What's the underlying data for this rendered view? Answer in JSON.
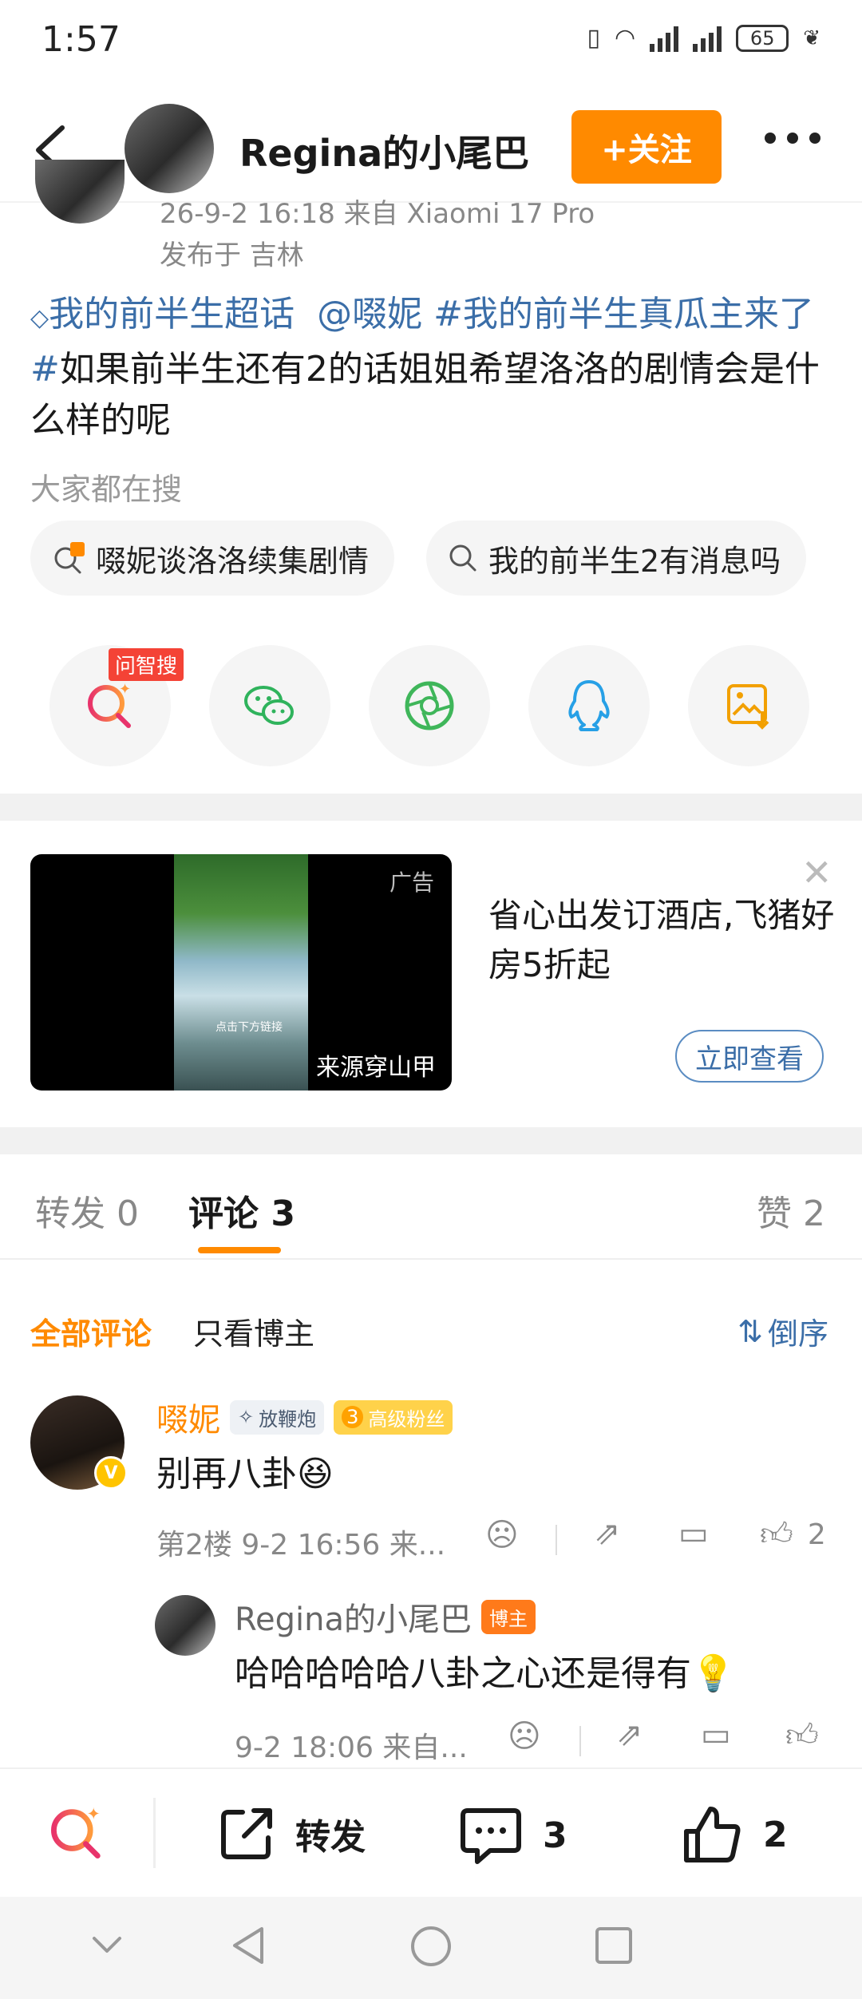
{
  "status": {
    "time": "1:57",
    "battery": "65"
  },
  "header": {
    "title": "Regina的小尾巴",
    "follow_label": "+关注"
  },
  "post": {
    "timestamp": "26-9-2 16:18 来自 Xiaomi 17 Pro",
    "location": "发布于 吉林",
    "text_parts": {
      "supertopic": "我的前半生超话",
      "mention": "@啜妮",
      "hashtag_1": "#我的前半生真瓜主",
      "hashtag_2": "来了#",
      "body": "如果前半生还有2的话姐姐希望洛洛的剧情会是什么样的呢"
    },
    "search_label": "大家都在搜",
    "search_pills": [
      "啜妮谈洛洛续集剧情",
      "我的前半生2有消息吗"
    ],
    "share_tag": "问智搜"
  },
  "ad": {
    "tag": "广告",
    "source": "来源穿山甲",
    "caption": "点击下方链接",
    "title": "省心出发订酒店,飞猪好房5折起",
    "cta": "立即查看"
  },
  "tabs": {
    "repost": "转发 0",
    "comments": "评论 3",
    "likes": "赞 2"
  },
  "filters": {
    "all": "全部评论",
    "blogger_only": "只看博主",
    "sort": "倒序"
  },
  "comments": [
    {
      "name": "啜妮",
      "badge_1": "放鞭炮",
      "badge_2_level": "3",
      "badge_2": "高级粉丝",
      "body": "别再八卦",
      "meta": "第2楼 9-2 16:56 来...",
      "likes": "2"
    }
  ],
  "reply": {
    "name": "Regina的小尾巴",
    "badge": "博主",
    "body": "哈哈哈哈哈八卦之心还是得有",
    "meta": "9-2 18:06 来自..."
  },
  "bottom_bar": {
    "repost": "转发",
    "comments": "3",
    "likes": "2"
  },
  "colors": {
    "accent": "#ff8a00",
    "link": "#3b6ea8",
    "ad_button": "#5a8cc2"
  }
}
